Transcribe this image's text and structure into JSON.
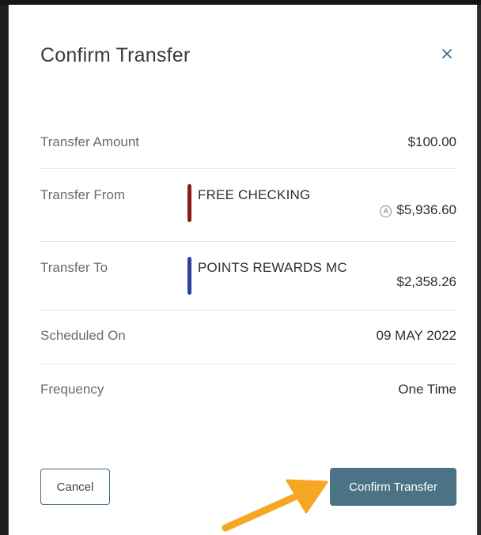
{
  "modal": {
    "title": "Confirm Transfer",
    "close_icon": "close-icon"
  },
  "details": {
    "amount": {
      "label": "Transfer Amount",
      "value": "$100.00"
    },
    "from": {
      "label": "Transfer From",
      "account_name": "FREE CHECKING",
      "account_color": "#8b1a1a",
      "available_badge": "A",
      "balance": "$5,936.60"
    },
    "to": {
      "label": "Transfer To",
      "account_name": "POINTS REWARDS MC",
      "account_color": "#2e3f9a",
      "balance": "$2,358.26"
    },
    "scheduled": {
      "label": "Scheduled On",
      "value": "09 MAY 2022"
    },
    "frequency": {
      "label": "Frequency",
      "value": "One Time"
    }
  },
  "actions": {
    "cancel_label": "Cancel",
    "confirm_label": "Confirm Transfer"
  },
  "colors": {
    "primary_button": "#4a7386",
    "annotation_arrow": "#f5a623"
  }
}
